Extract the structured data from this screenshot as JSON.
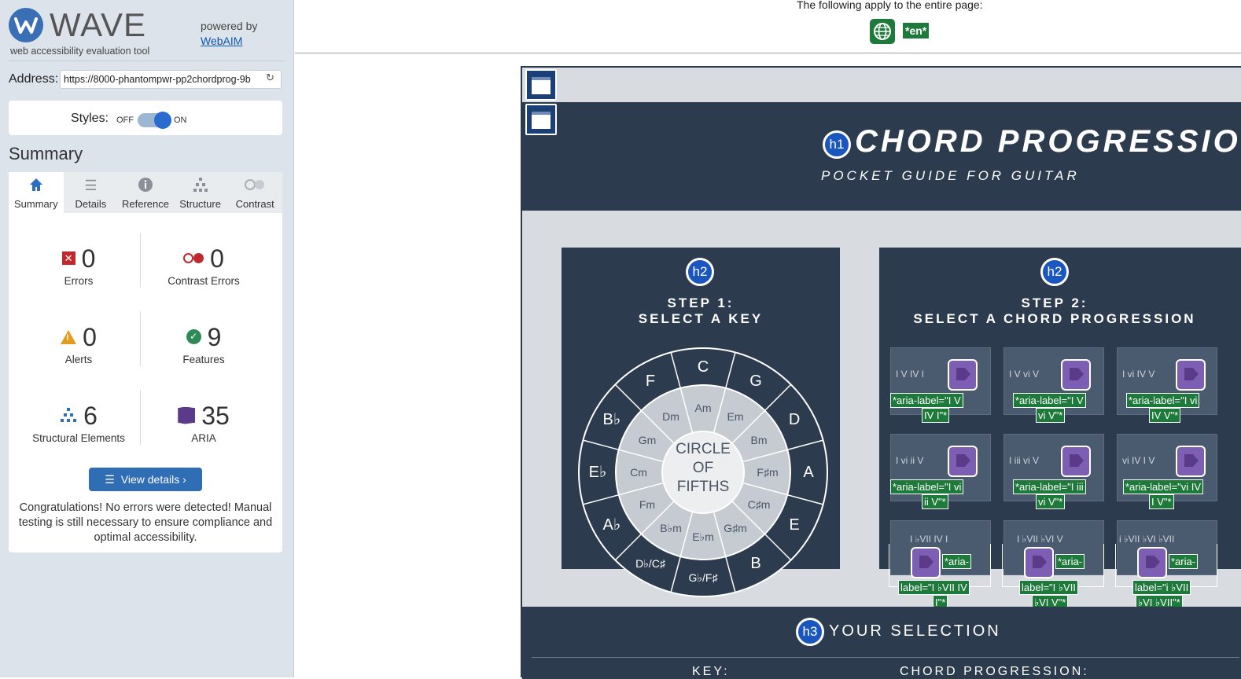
{
  "sidebar": {
    "logo_text": "WAVE",
    "logo_tagline": "web accessibility evaluation tool",
    "powered_by": "powered by",
    "webaim_link": "WebAIM",
    "address_label": "Address:",
    "address_value": "https://8000-phantompwr-pp2chordprog-9b",
    "styles_label": "Styles:",
    "styles_off": "OFF",
    "styles_on": "ON",
    "summary_title": "Summary",
    "tabs": [
      {
        "label": "Summary"
      },
      {
        "label": "Details"
      },
      {
        "label": "Reference"
      },
      {
        "label": "Structure"
      },
      {
        "label": "Contrast"
      }
    ],
    "stats": {
      "errors": {
        "count": "0",
        "label": "Errors"
      },
      "contrast_errors": {
        "count": "0",
        "label": "Contrast Errors"
      },
      "alerts": {
        "count": "0",
        "label": "Alerts"
      },
      "features": {
        "count": "9",
        "label": "Features"
      },
      "structural": {
        "count": "6",
        "label": "Structural Elements"
      },
      "aria": {
        "count": "35",
        "label": "ARIA"
      }
    },
    "view_details": "View details ›",
    "congrats": "Congratulations! No errors were detected! Manual testing is still necessary to ensure compliance and optimal accessibility."
  },
  "topbar": {
    "text": "The following apply to the entire page:",
    "lang_badge": "*en*"
  },
  "site": {
    "h1_badge": "h1",
    "h2_badge": "h2",
    "h3_badge": "h3",
    "title": "CHORD PROGRESSIONS",
    "subtitle": "POCKET GUIDE FOR GUITAR",
    "step1_line1": "STEP 1:",
    "step1_line2": "SELECT A KEY",
    "step2_line1": "STEP 2:",
    "step2_line2": "SELECT A CHORD PROGRESSION",
    "circle_center": [
      "CIRCLE",
      "OF",
      "FIFTHS"
    ],
    "outer_keys": [
      "C",
      "G",
      "D",
      "A",
      "E",
      "B",
      "G♭/F♯",
      "D♭/C♯",
      "A♭",
      "E♭",
      "B♭",
      "F"
    ],
    "inner_keys": [
      "Am",
      "Em",
      "Bm",
      "F♯m",
      "C♯m",
      "G♯m",
      "E♭m",
      "B♭m",
      "Fm",
      "Cm",
      "Gm",
      "Dm"
    ],
    "progressions": [
      {
        "numerals": "I  V  IV  I",
        "aria1": "*aria-label=\"I  V",
        "aria2": "IV  I\"*"
      },
      {
        "numerals": "I  V  vi  V",
        "aria1": "*aria-label=\"I  V",
        "aria2": "vi  V\"*"
      },
      {
        "numerals": "I  vi  IV  V",
        "aria1": "*aria-label=\"I  vi",
        "aria2": "IV  V\"*"
      },
      {
        "numerals": "I  vi  ii  V",
        "aria1": "*aria-label=\"I  vi",
        "aria2": "ii  V\"*"
      },
      {
        "numerals": "I  iii  vi  V",
        "aria1": "*aria-label=\"I  iii",
        "aria2": "vi  V\"*"
      },
      {
        "numerals": "vi  IV  I  V",
        "aria1": "*aria-label=\"vi  IV",
        "aria2": "I  V\"*"
      },
      {
        "numerals": "I  ♭VII  IV  I",
        "aria1": "*aria-",
        "aria2": "label=\"I  ♭VII  IV",
        "aria3": "I\"*"
      },
      {
        "numerals": "I  ♭VII  ♭VI  V",
        "aria1": "*aria-",
        "aria2": "label=\"I  ♭VII",
        "aria3": "♭VI  V\"*"
      },
      {
        "numerals": "i  ♭VII  ♭VI  ♭VII",
        "aria1": "*aria-",
        "aria2": "label=\"i  ♭VII",
        "aria3": "♭VI  ♭VII\"*"
      }
    ],
    "your_selection": "YOUR SELECTION",
    "key_label": "KEY:",
    "progression_label": "CHORD PROGRESSION:"
  },
  "colors": {
    "navy": "#2d3b4f",
    "wave_blue": "#2f6db4",
    "green": "#1d7a3b",
    "error_red": "#c0282d"
  }
}
